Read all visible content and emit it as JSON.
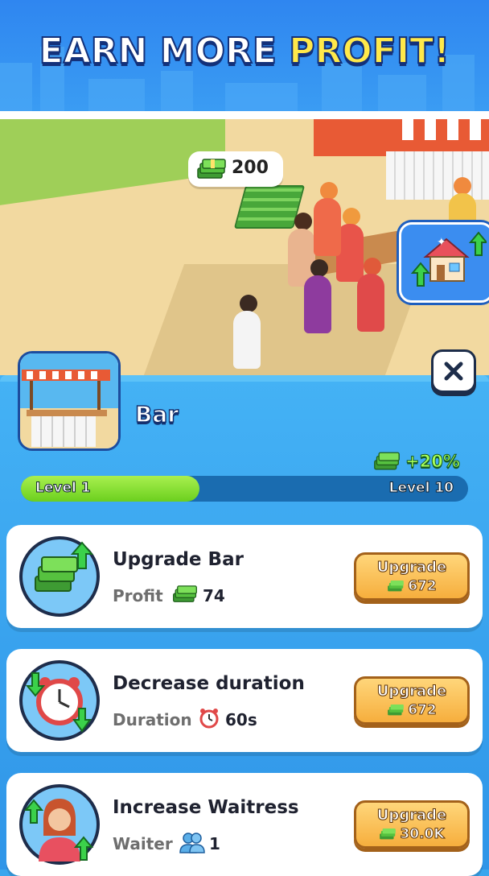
{
  "banner": {
    "title_white": "EARN MORE",
    "title_yellow": "PROFIT!"
  },
  "scene": {
    "cash_bubble_value": "200",
    "cash_icon": "cash-stack-icon",
    "house_upgrade_icon": "house-upgrade-icon"
  },
  "building": {
    "name": "Bar",
    "bonus": "+20%"
  },
  "level": {
    "current_label": "Level 1",
    "max_label": "Level 10",
    "progress_fraction": 0.4
  },
  "upgrades": [
    {
      "title": "Upgrade Bar",
      "stat_label": "Profit",
      "stat_icon": "cash-icon",
      "stat_value": "74",
      "button_label": "Upgrade",
      "cost": "672"
    },
    {
      "title": "Decrease duration",
      "stat_label": "Duration",
      "stat_icon": "alarm-clock-icon",
      "stat_value": "60s",
      "button_label": "Upgrade",
      "cost": "672"
    },
    {
      "title": "Increase Waitress",
      "stat_label": "Waiter",
      "stat_icon": "people-icon",
      "stat_value": "1",
      "button_label": "Upgrade",
      "cost": "30.0K"
    }
  ],
  "colors": {
    "panel_blue": "#3aa6ee",
    "button_orange": "#f6ae3d",
    "progress_green": "#8be034",
    "bonus_green": "#a8ff5a"
  }
}
